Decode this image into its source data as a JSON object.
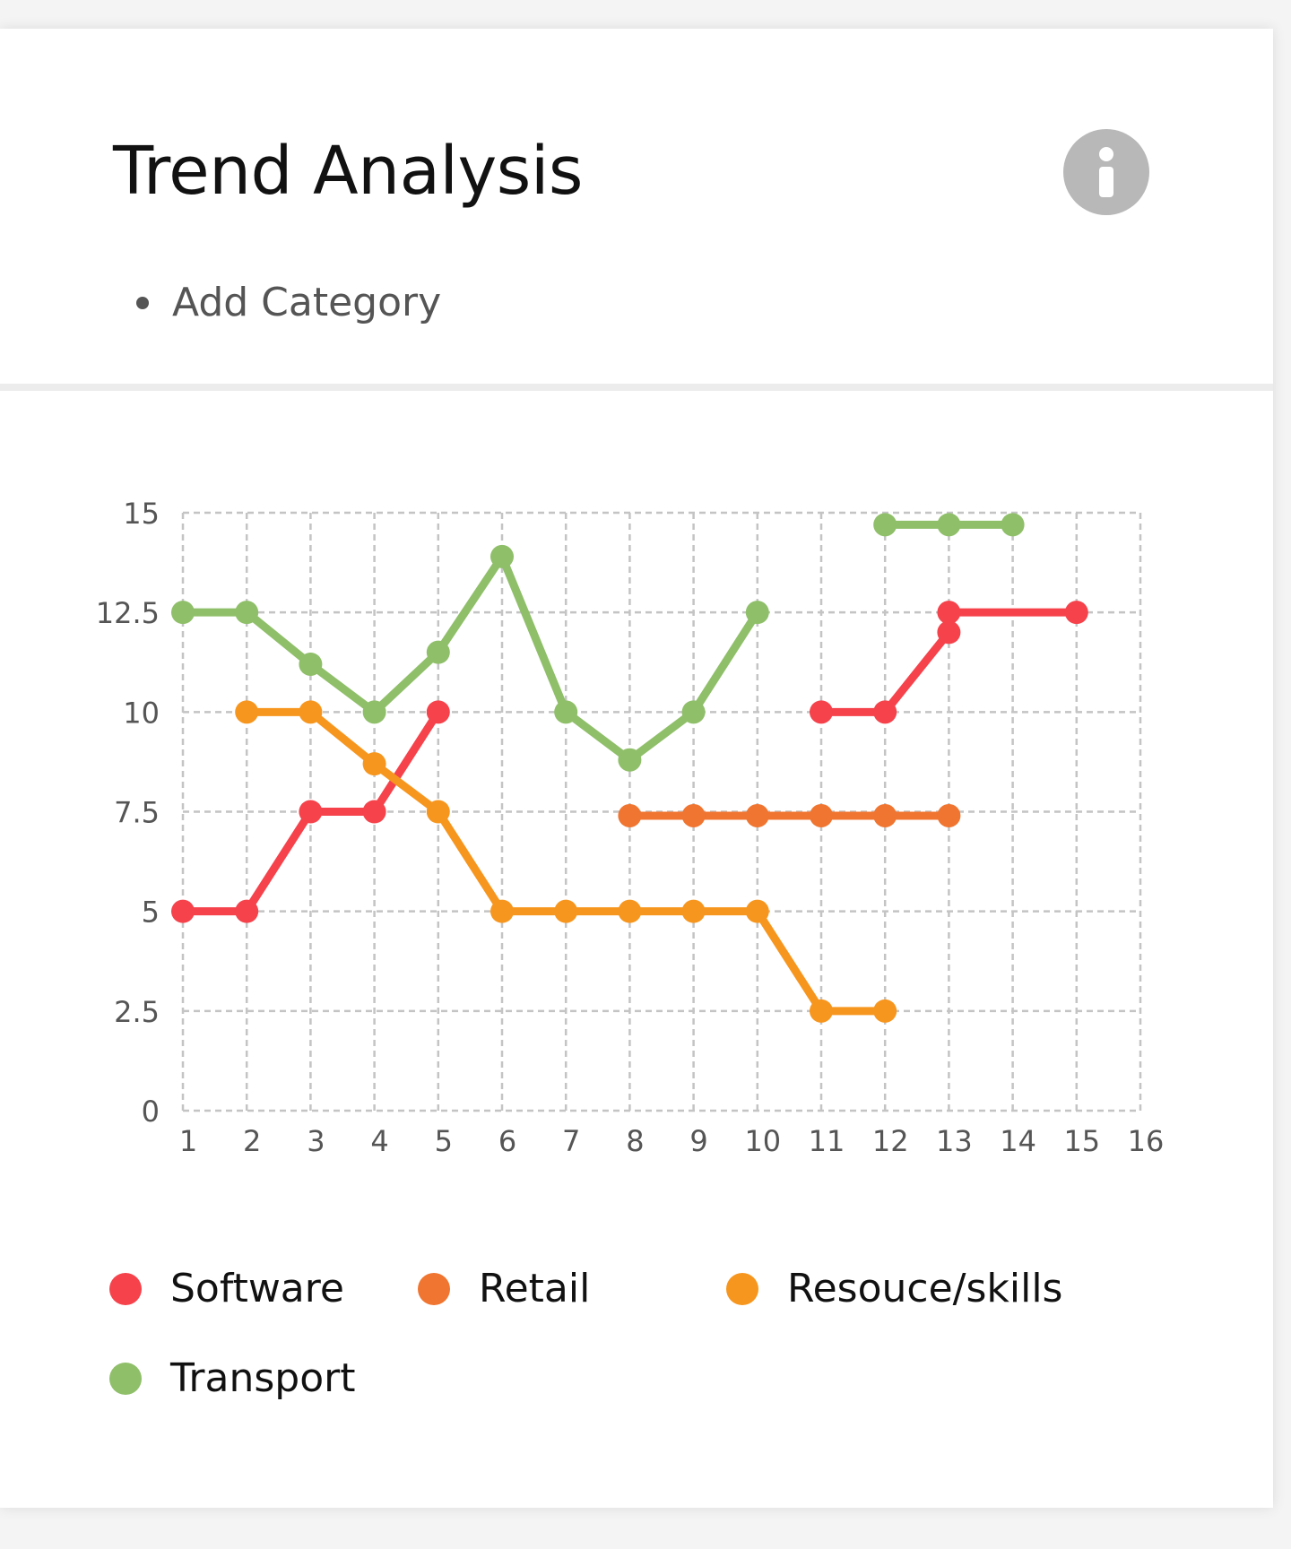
{
  "header": {
    "title": "Trend Analysis",
    "add_category_label": "Add Category",
    "info_icon": "info-icon"
  },
  "chart_data": {
    "type": "line",
    "x": [
      1,
      2,
      3,
      4,
      5,
      6,
      7,
      8,
      9,
      10,
      11,
      12,
      13,
      14,
      15,
      16
    ],
    "xlim": [
      1,
      16
    ],
    "ylim": [
      0,
      15
    ],
    "y_ticks": [
      "0",
      "2.5",
      "5",
      "7.5",
      "10",
      "12.5",
      "15"
    ],
    "x_ticks": [
      "1",
      "2",
      "3",
      "4",
      "5",
      "6",
      "7",
      "8",
      "9",
      "10",
      "11",
      "12",
      "13",
      "14",
      "15",
      "16"
    ],
    "grid": true,
    "grid_style": "dashed",
    "legend_position": "bottom",
    "series": [
      {
        "name": "Software",
        "color": "#f5424b",
        "segments": [
          [
            [
              1,
              5
            ],
            [
              2,
              5
            ],
            [
              3,
              7.5
            ],
            [
              4,
              7.5
            ],
            [
              5,
              10
            ]
          ],
          [
            [
              11,
              10
            ],
            [
              12,
              10
            ],
            [
              13,
              12
            ],
            [
              13,
              12.5
            ],
            [
              15,
              12.5
            ]
          ]
        ]
      },
      {
        "name": "Retail",
        "color": "#f07530",
        "segments": [
          [
            [
              8,
              7.4
            ],
            [
              9,
              7.4
            ],
            [
              10,
              7.4
            ],
            [
              11,
              7.4
            ],
            [
              12,
              7.4
            ],
            [
              13,
              7.4
            ]
          ]
        ]
      },
      {
        "name": "Resouce/skills",
        "color": "#f7961e",
        "segments": [
          [
            [
              2,
              10
            ],
            [
              3,
              10
            ],
            [
              4,
              8.7
            ],
            [
              5,
              7.5
            ],
            [
              6,
              5
            ],
            [
              7,
              5
            ],
            [
              8,
              5
            ],
            [
              9,
              5
            ],
            [
              10,
              5
            ],
            [
              11,
              2.5
            ],
            [
              12,
              2.5
            ]
          ]
        ]
      },
      {
        "name": "Transport",
        "color": "#8fbf69",
        "segments": [
          [
            [
              1,
              12.5
            ],
            [
              2,
              12.5
            ],
            [
              3,
              11.2
            ],
            [
              4,
              10
            ],
            [
              5,
              11.5
            ],
            [
              6,
              13.9
            ],
            [
              7,
              10
            ],
            [
              8,
              8.8
            ],
            [
              9,
              10
            ],
            [
              10,
              12.5
            ]
          ],
          [
            [
              12,
              14.7
            ],
            [
              13,
              14.7
            ],
            [
              14,
              14.7
            ]
          ]
        ]
      }
    ]
  }
}
